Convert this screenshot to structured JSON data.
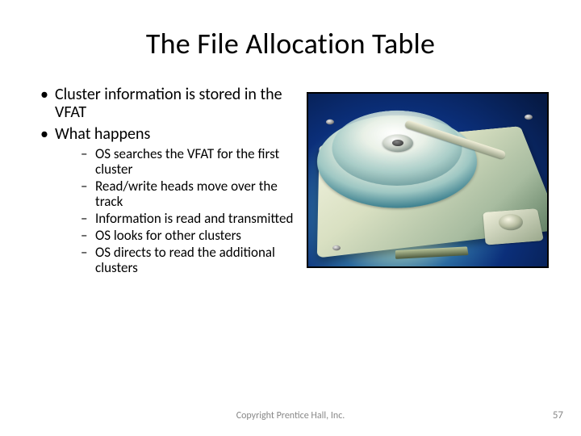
{
  "title": "The File Allocation Table",
  "bullets": [
    {
      "text": "Cluster information is stored in the VFAT"
    },
    {
      "text": "What happens"
    }
  ],
  "sub_bullets": [
    {
      "text": "OS searches the VFAT for the first cluster"
    },
    {
      "text": "Read/write heads move over the track"
    },
    {
      "text": "Information is read and transmitted"
    },
    {
      "text": "OS looks for other clusters"
    },
    {
      "text": "OS directs to read the additional clusters"
    }
  ],
  "image": {
    "desc": "hard-disk-drive-open-view"
  },
  "footer": {
    "copyright": "Copyright Prentice Hall, Inc.",
    "page_number": "57"
  }
}
